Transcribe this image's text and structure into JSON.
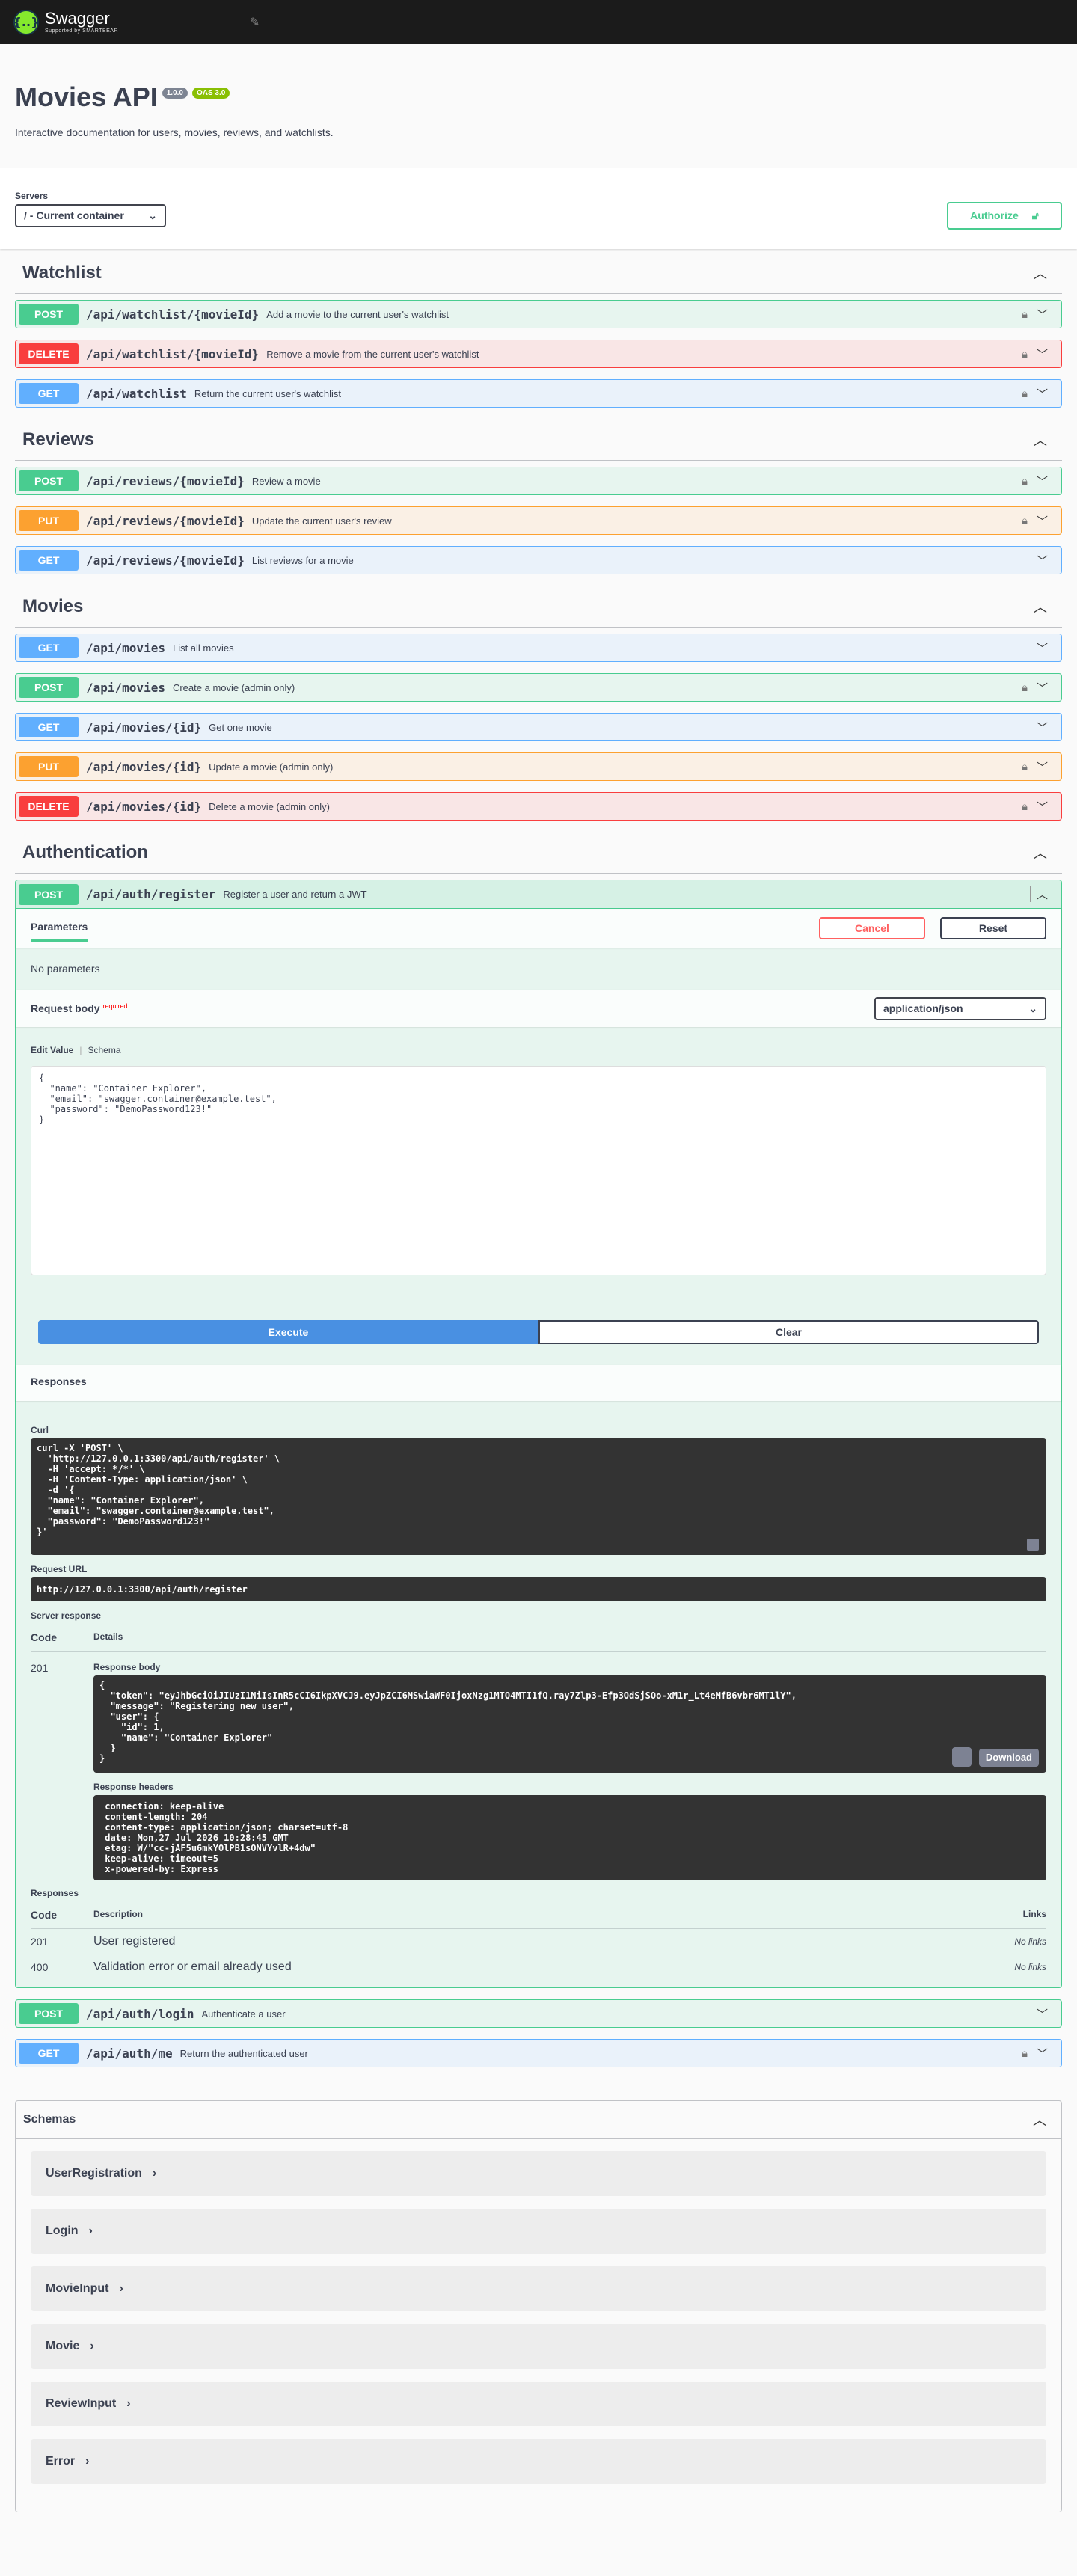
{
  "topbar": {
    "brand": "Swagger",
    "sub": "Supported by SMARTBEAR",
    "logo_glyph": "{..}",
    "icon": "link-icon"
  },
  "info": {
    "title": "Movies API",
    "version": "1.0.0",
    "oas": "OAS 3.0",
    "description": "Interactive documentation for users, movies, reviews, and watchlists."
  },
  "servers": {
    "label": "Servers",
    "selected": "/ - Current container",
    "authorize": "Authorize"
  },
  "tags": {
    "watchlist": {
      "name": "Watchlist",
      "ops": [
        {
          "method": "POST",
          "path": "/api/watchlist/{movieId}",
          "summary": "Add a movie to the current user's watchlist"
        },
        {
          "method": "DELETE",
          "path": "/api/watchlist/{movieId}",
          "summary": "Remove a movie from the current user's watchlist"
        },
        {
          "method": "GET",
          "path": "/api/watchlist",
          "summary": "Return the current user's watchlist"
        }
      ]
    },
    "reviews": {
      "name": "Reviews",
      "ops": [
        {
          "method": "POST",
          "path": "/api/reviews/{movieId}",
          "summary": "Review a movie"
        },
        {
          "method": "PUT",
          "path": "/api/reviews/{movieId}",
          "summary": "Update the current user's review"
        },
        {
          "method": "GET",
          "path": "/api/reviews/{movieId}",
          "summary": "List reviews for a movie"
        }
      ]
    },
    "movies": {
      "name": "Movies",
      "ops": [
        {
          "method": "GET",
          "path": "/api/movies",
          "summary": "List all movies"
        },
        {
          "method": "POST",
          "path": "/api/movies",
          "summary": "Create a movie (admin only)"
        },
        {
          "method": "GET",
          "path": "/api/movies/{id}",
          "summary": "Get one movie"
        },
        {
          "method": "PUT",
          "path": "/api/movies/{id}",
          "summary": "Update a movie (admin only)"
        },
        {
          "method": "DELETE",
          "path": "/api/movies/{id}",
          "summary": "Delete a movie (admin only)"
        }
      ]
    },
    "auth": {
      "name": "Authentication",
      "ops": [
        {
          "method": "POST",
          "path": "/api/auth/register",
          "summary": "Register a user and return a JWT"
        },
        {
          "method": "POST",
          "path": "/api/auth/login",
          "summary": "Authenticate a user"
        },
        {
          "method": "GET",
          "path": "/api/auth/me",
          "summary": "Return the authenticated user"
        }
      ]
    }
  },
  "expanded": {
    "parameters_tab": "Parameters",
    "cancel": "Cancel",
    "reset": "Reset",
    "no_params": "No parameters",
    "request_body": "Request body",
    "required": "required",
    "content_type": "application/json",
    "edit_value": "Edit Value",
    "schema": "Schema",
    "body": "{\n  \"name\": \"Container Explorer\",\n  \"email\": \"swagger.container@example.test\",\n  \"password\": \"DemoPassword123!\"\n}",
    "execute": "Execute",
    "clear": "Clear",
    "responses": "Responses",
    "curl_label": "Curl",
    "curl_lines": [
      "curl -X 'POST' \\",
      "  'http://127.0.0.1:3300/api/auth/register' \\",
      "  -H 'accept: */*' \\",
      "  -H 'Content-Type: application/json' \\",
      "  -d '{",
      "  \"name\": \"Container Explorer\",",
      "  \"email\": \"swagger.container@example.test\",",
      "  \"password\": \"DemoPassword123!\"",
      "}'"
    ],
    "request_url_label": "Request URL",
    "request_url": "http://127.0.0.1:3300/api/auth/register",
    "server_response": "Server response",
    "code_h": "Code",
    "details_h": "Details",
    "resp_code": "201",
    "resp_body_label": "Response body",
    "resp_body_lines": [
      "{",
      "  \"token\": \"eyJhbGciOiJIUzI1NiIsInR5cCI6IkpXVCJ9.eyJpZCI6MSwiaWF0IjoxNzg1MTQ4MTI1fQ.ray7Zlp3-Efp3OdSjSOo-xM1r_Lt4eMfB6vbr6MT1lY\",",
      "  \"message\": \"Registering new user\",",
      "  \"user\": {",
      "    \"id\": 1,",
      "    \"name\": \"Container Explorer\"",
      "  }",
      "}"
    ],
    "download": "Download",
    "resp_headers_label": "Response headers",
    "resp_headers_lines": [
      " connection: keep-alive",
      " content-length: 204",
      " content-type: application/json; charset=utf-8",
      " date: Mon,27 Jul 2026 10:28:45 GMT",
      " etag: W/\"cc-jAF5u6mkYOlPB1sONVYvlR+4dw\"",
      " keep-alive: timeout=5",
      " x-powered-by: Express"
    ],
    "responses_label": "Responses",
    "description_h": "Description",
    "links_h": "Links",
    "resp_rows": [
      {
        "code": "201",
        "desc": "User registered",
        "links": "No links"
      },
      {
        "code": "400",
        "desc": "Validation error or email already used",
        "links": "No links"
      }
    ]
  },
  "schemas": {
    "title": "Schemas",
    "items": [
      "UserRegistration",
      "Login",
      "MovieInput",
      "Movie",
      "ReviewInput",
      "Error"
    ]
  },
  "colors": {
    "post": "#49cc90",
    "get": "#61affe",
    "put": "#fca130",
    "delete": "#f93e3e",
    "execute": "#4990e2"
  }
}
